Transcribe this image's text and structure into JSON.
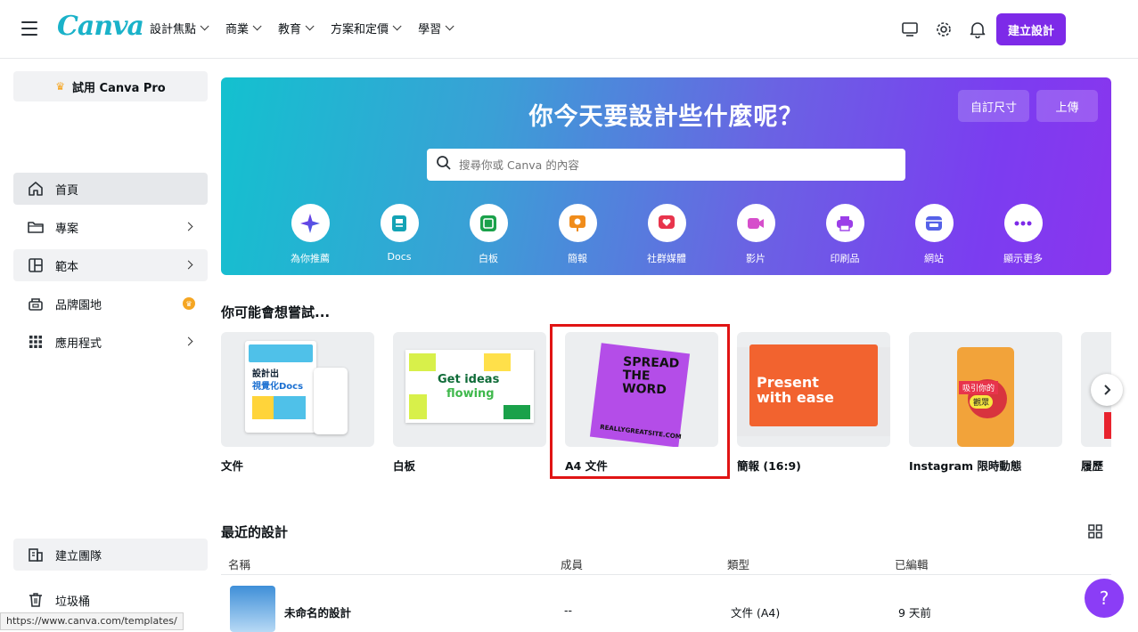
{
  "logo": "Canva",
  "nav": [
    "設計焦點",
    "商業",
    "教育",
    "方案和定價",
    "學習"
  ],
  "top_icons": [
    "desktop-icon",
    "gear-icon",
    "bell-icon"
  ],
  "create_button": "建立設計",
  "sidebar": {
    "pro": "試用 Canva Pro",
    "items": [
      {
        "label": "首頁",
        "icon": "home-icon"
      },
      {
        "label": "專案",
        "icon": "folder-icon"
      },
      {
        "label": "範本",
        "icon": "template-icon"
      },
      {
        "label": "品牌園地",
        "icon": "brand-icon"
      },
      {
        "label": "應用程式",
        "icon": "apps-icon"
      }
    ],
    "create_team": "建立團隊",
    "trash": "垃圾桶"
  },
  "hero": {
    "title": "你今天要設計些什麼呢？",
    "custom_size": "自訂尺寸",
    "upload": "上傳",
    "search_placeholder": "搜尋你或 Canva 的內容",
    "categories": [
      {
        "label": "為你推薦",
        "icon": "sparkle-icon"
      },
      {
        "label": "Docs",
        "icon": "doc-icon"
      },
      {
        "label": "白板",
        "icon": "whiteboard-icon"
      },
      {
        "label": "簡報",
        "icon": "presentation-icon"
      },
      {
        "label": "社群媒體",
        "icon": "heart-icon"
      },
      {
        "label": "影片",
        "icon": "video-icon"
      },
      {
        "label": "印刷品",
        "icon": "print-icon"
      },
      {
        "label": "網站",
        "icon": "website-icon"
      },
      {
        "label": "顯示更多",
        "icon": "more-icon"
      }
    ]
  },
  "suggest_title": "你可能會想嘗試...",
  "suggestions": [
    {
      "label": "文件",
      "thumb_a": "設計出",
      "thumb_b": "視覺化Docs"
    },
    {
      "label": "白板",
      "thumb_a": "Get ideas",
      "thumb_b": "flowing"
    },
    {
      "label": "A4 文件",
      "thumb_a": "SPREAD",
      "thumb_b": "THE WORD",
      "thumb_c": "REALLYGREATSITE.COM"
    },
    {
      "label": "簡報 (16:9)",
      "thumb_a": "Present",
      "thumb_b": "with ease"
    },
    {
      "label": "Instagram 限時動態",
      "thumb_a": "吸引你的",
      "thumb_b": "觀眾"
    },
    {
      "label": "履歷"
    }
  ],
  "recent_title": "最近的設計",
  "table": {
    "headers": [
      "名稱",
      "成員",
      "類型",
      "已編輯"
    ],
    "rows": [
      {
        "name": "未命名的設計",
        "members": "--",
        "type": "文件 (A4)",
        "edited": "9 天前"
      }
    ]
  },
  "help": "?",
  "status_url": "https://www.canva.com/templates/"
}
